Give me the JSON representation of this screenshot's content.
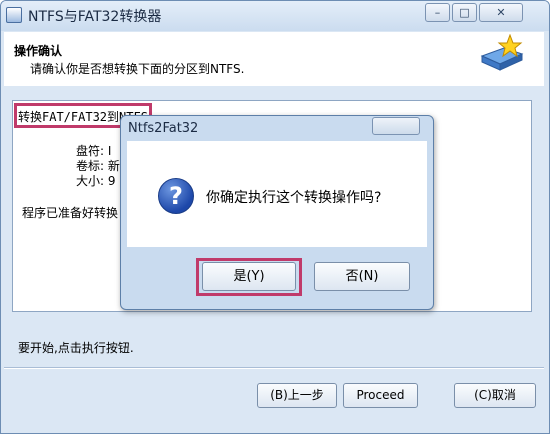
{
  "window": {
    "title": "NTFS与FAT32转换器",
    "controls": {
      "minimize": "–",
      "maximize": "□",
      "close": "✕"
    }
  },
  "header": {
    "title": "操作确认",
    "subtitle": "请确认你是否想转换下面的分区到NTFS."
  },
  "content": {
    "operation": "转换FAT/FAT32到NTFS",
    "drive_label": "盘符: I",
    "volume_label": "卷标: 新",
    "size_label": "大小: 9",
    "ready_text": "程序已准备好转换"
  },
  "hint": "要开始,点击执行按钮.",
  "buttons": {
    "back": "(B)上一步",
    "proceed": "Proceed",
    "cancel": "(C)取消"
  },
  "dialog": {
    "title": "Ntfs2Fat32",
    "question": "你确定执行这个转换操作吗?",
    "yes": "是(Y)",
    "no": "否(N)",
    "icon_glyph": "?"
  },
  "colors": {
    "highlight": "#c03a6a",
    "window_bg": "#dbe7f4"
  }
}
